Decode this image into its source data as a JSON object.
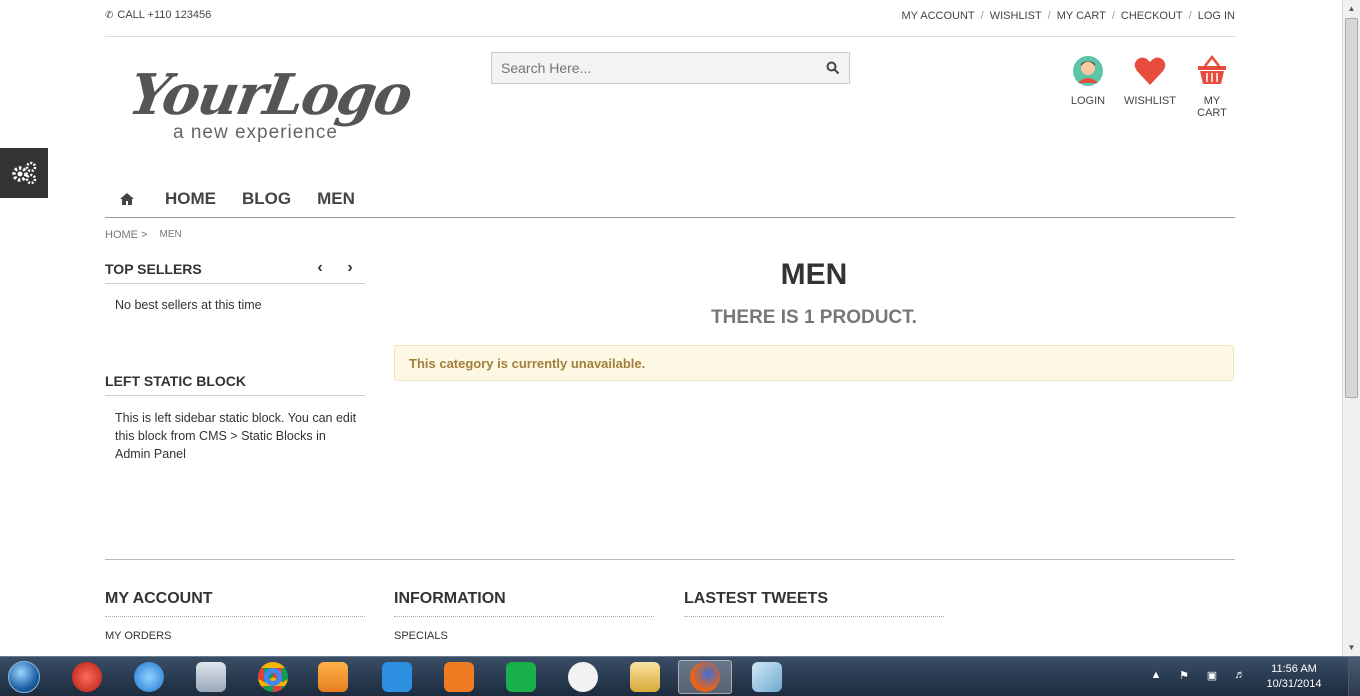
{
  "topbar": {
    "call": "CALL +110 123456",
    "links": [
      "MY ACCOUNT",
      "WISHLIST",
      "MY CART",
      "CHECKOUT",
      "LOG IN"
    ]
  },
  "logo": {
    "script": "YourLogo",
    "tagline": "a new experience"
  },
  "search": {
    "placeholder": "Search Here..."
  },
  "header_icons": {
    "login": "LOGIN",
    "wishlist": "WISHLIST",
    "cart": "MY CART"
  },
  "nav": {
    "items": [
      "HOME",
      "BLOG",
      "MEN"
    ]
  },
  "breadcrumb": {
    "home": "HOME >",
    "current": "MEN"
  },
  "sidebar": {
    "top_sellers_title": "TOP SELLERS",
    "top_sellers_text": "No best sellers at this time",
    "left_block_title": "LEFT STATIC BLOCK",
    "left_block_text": "This is left sidebar static block. You can edit this block from CMS > Static Blocks in Admin Panel"
  },
  "main": {
    "title": "MEN",
    "subtitle": "THERE IS 1 PRODUCT.",
    "alert": "This category is currently unavailable."
  },
  "footer": {
    "col1_title": "MY ACCOUNT",
    "col1_link": "MY ORDERS",
    "col2_title": "INFORMATION",
    "col2_link": "SPECIALS",
    "col3_title": "LASTEST TWEETS"
  },
  "taskbar": {
    "time": "11:56 AM",
    "date": "10/31/2014"
  },
  "colors": {
    "accent_red": "#e74c3c",
    "alert_bg": "#fcf8e3",
    "alert_text": "#a47e3c"
  }
}
